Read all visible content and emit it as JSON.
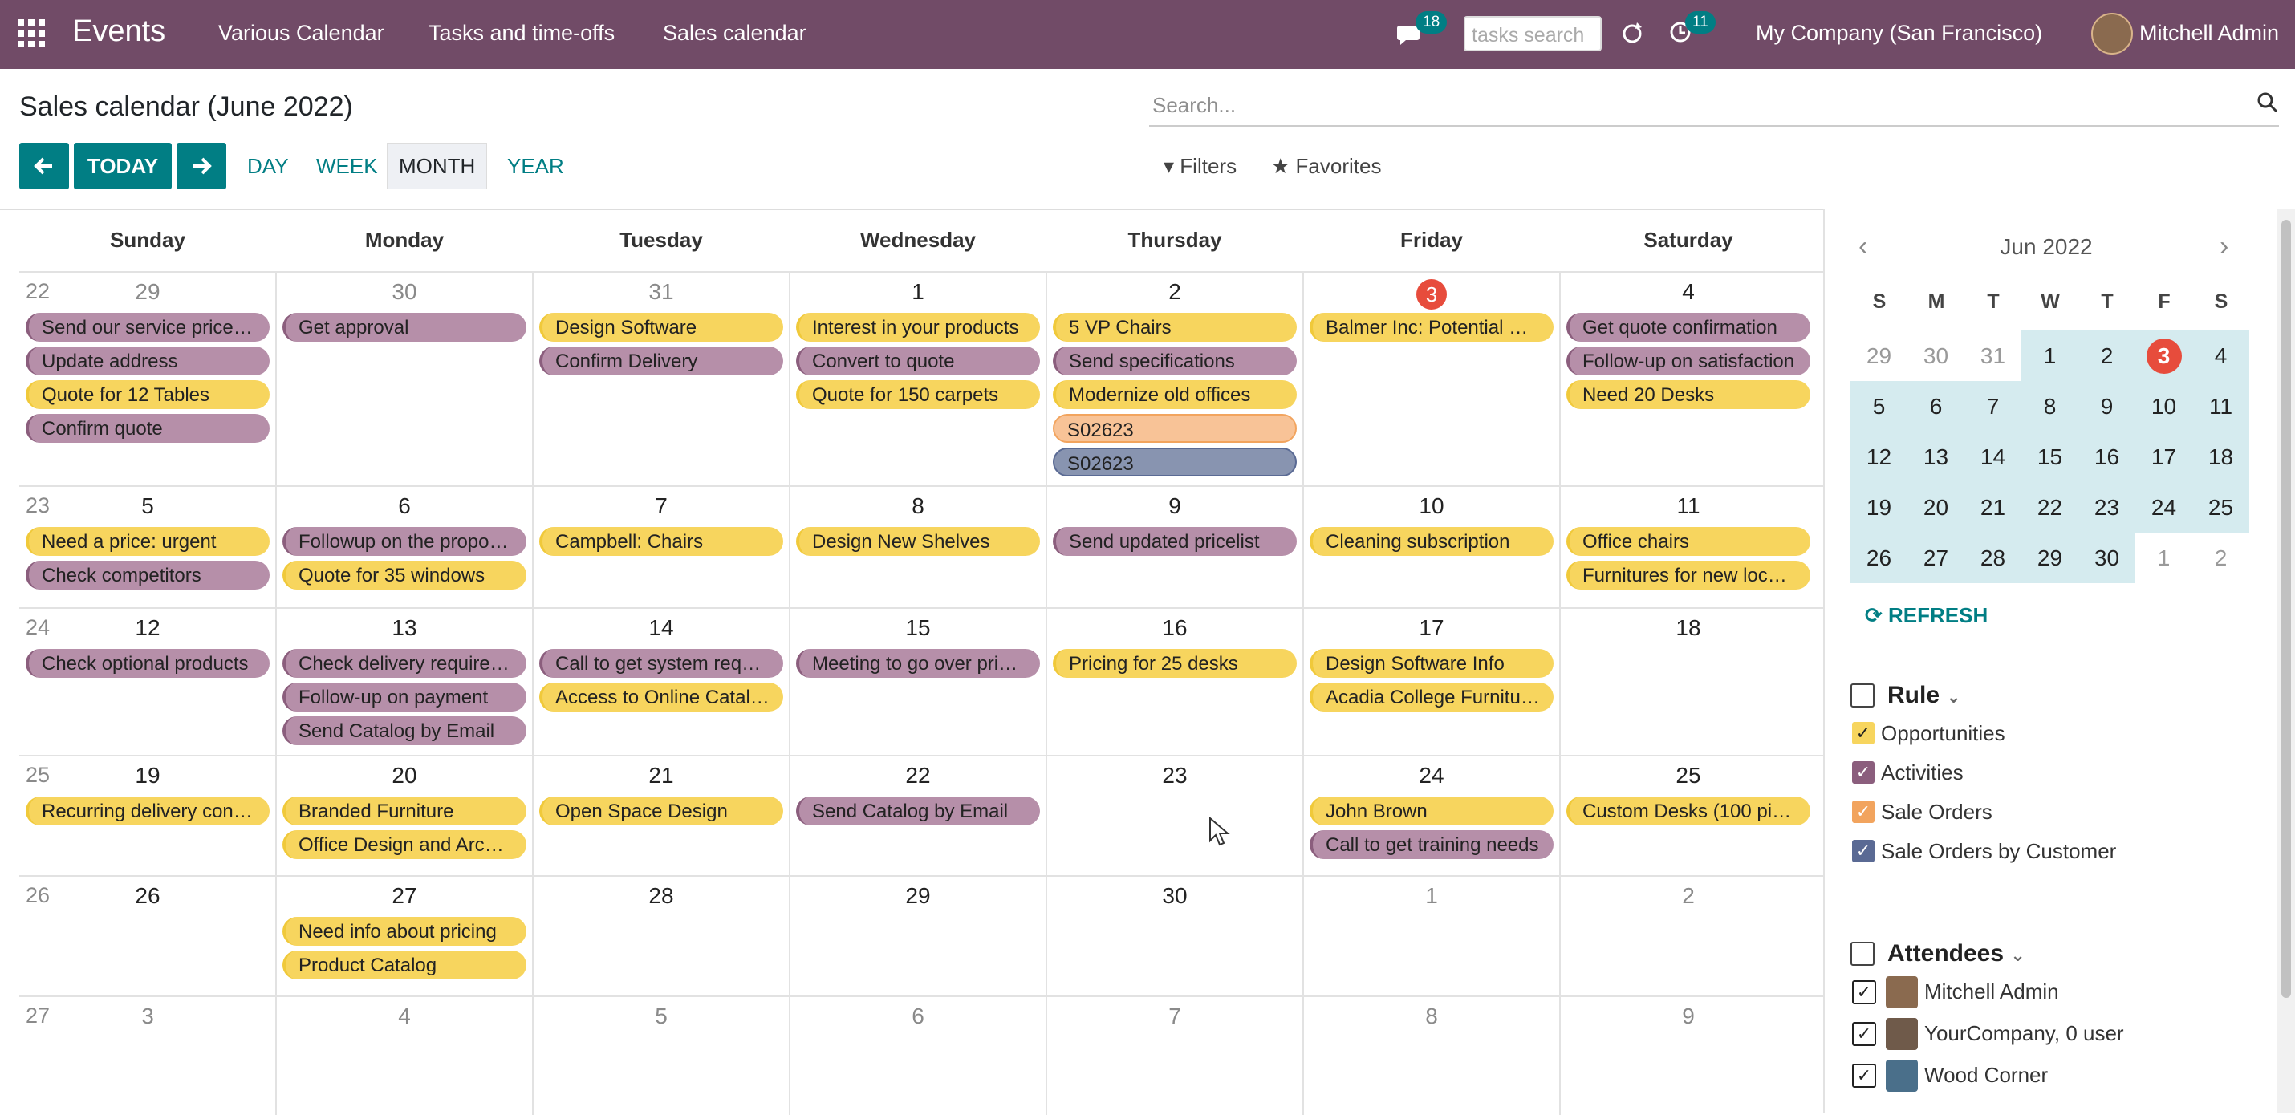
{
  "navbar": {
    "brand": "Events",
    "menu": [
      "Various Calendar",
      "Tasks and time-offs",
      "Sales calendar"
    ],
    "messages_count": "18",
    "activities_count": "11",
    "search_placeholder": "tasks search",
    "company": "My Company (San Francisco)",
    "user": "Mitchell Admin"
  },
  "page": {
    "title": "Sales calendar (June 2022)",
    "search_placeholder": "Search...",
    "today_label": "TODAY",
    "scales": [
      "DAY",
      "WEEK",
      "MONTH",
      "YEAR"
    ],
    "active_scale": "MONTH",
    "filters_label": "Filters",
    "favorites_label": "Favorites"
  },
  "calendar": {
    "day_headers": [
      "Sunday",
      "Monday",
      "Tuesday",
      "Wednesday",
      "Thursday",
      "Friday",
      "Saturday"
    ],
    "weeks": [
      {
        "week": "22",
        "days": [
          {
            "n": "29",
            "muted": true,
            "events": [
              {
                "t": "Send our service pricelist",
                "c": "p"
              },
              {
                "t": "Update address",
                "c": "p"
              },
              {
                "t": "Quote for 12 Tables",
                "c": "y"
              },
              {
                "t": "Confirm quote",
                "c": "p"
              }
            ]
          },
          {
            "n": "30",
            "muted": true,
            "events": [
              {
                "t": "Get approval",
                "c": "p"
              }
            ]
          },
          {
            "n": "31",
            "muted": true,
            "events": [
              {
                "t": "Design Software",
                "c": "y"
              },
              {
                "t": "Confirm Delivery",
                "c": "p"
              }
            ]
          },
          {
            "n": "1",
            "events": [
              {
                "t": "Interest in your products",
                "c": "y"
              },
              {
                "t": "Convert to quote",
                "c": "p"
              },
              {
                "t": "Quote for 150 carpets",
                "c": "y"
              }
            ]
          },
          {
            "n": "2",
            "events": [
              {
                "t": "5 VP Chairs",
                "c": "y"
              },
              {
                "t": "Send specifications",
                "c": "p"
              },
              {
                "t": "Modernize old offices",
                "c": "y"
              },
              {
                "t": "S02623",
                "c": "o"
              },
              {
                "t": "S02623",
                "c": "s"
              }
            ]
          },
          {
            "n": "3",
            "today": true,
            "events": [
              {
                "t": "Balmer Inc: Potential Di...",
                "c": "y"
              }
            ]
          },
          {
            "n": "4",
            "events": [
              {
                "t": "Get quote confirmation",
                "c": "p"
              },
              {
                "t": "Follow-up on satisfaction",
                "c": "p"
              },
              {
                "t": "Need 20 Desks",
                "c": "y"
              }
            ]
          }
        ]
      },
      {
        "week": "23",
        "days": [
          {
            "n": "5",
            "events": [
              {
                "t": "Need a price: urgent",
                "c": "y"
              },
              {
                "t": "Check competitors",
                "c": "p"
              }
            ]
          },
          {
            "n": "6",
            "events": [
              {
                "t": "Followup on the proposal",
                "c": "p"
              },
              {
                "t": "Quote for 35 windows",
                "c": "y"
              }
            ]
          },
          {
            "n": "7",
            "events": [
              {
                "t": "Campbell: Chairs",
                "c": "y"
              }
            ]
          },
          {
            "n": "8",
            "events": [
              {
                "t": "Design New Shelves",
                "c": "y"
              }
            ]
          },
          {
            "n": "9",
            "events": [
              {
                "t": "Send updated pricelist",
                "c": "p"
              }
            ]
          },
          {
            "n": "10",
            "events": [
              {
                "t": "Cleaning subscription",
                "c": "y"
              }
            ]
          },
          {
            "n": "11",
            "events": [
              {
                "t": "Office chairs",
                "c": "y"
              },
              {
                "t": "Furnitures for new locati...",
                "c": "y"
              }
            ]
          }
        ]
      },
      {
        "week": "24",
        "days": [
          {
            "n": "12",
            "events": [
              {
                "t": "Check optional products",
                "c": "p"
              }
            ]
          },
          {
            "n": "13",
            "events": [
              {
                "t": "Check delivery requirem...",
                "c": "p"
              },
              {
                "t": "Follow-up on payment",
                "c": "p"
              },
              {
                "t": "Send Catalog by Email",
                "c": "p"
              }
            ]
          },
          {
            "n": "14",
            "events": [
              {
                "t": "Call to get system requir...",
                "c": "p"
              },
              {
                "t": "Access to Online Catalog",
                "c": "y"
              }
            ]
          },
          {
            "n": "15",
            "events": [
              {
                "t": "Meeting to go over prici...",
                "c": "p"
              }
            ]
          },
          {
            "n": "16",
            "events": [
              {
                "t": "Pricing for 25 desks",
                "c": "y"
              }
            ]
          },
          {
            "n": "17",
            "events": [
              {
                "t": "Design Software Info",
                "c": "y"
              },
              {
                "t": "Acadia College Furnitures",
                "c": "y"
              }
            ]
          },
          {
            "n": "18",
            "events": []
          }
        ]
      },
      {
        "week": "25",
        "days": [
          {
            "n": "19",
            "events": [
              {
                "t": "Recurring delivery contr...",
                "c": "y"
              }
            ]
          },
          {
            "n": "20",
            "events": [
              {
                "t": "Branded Furniture",
                "c": "y"
              },
              {
                "t": "Office Design and Archit...",
                "c": "y"
              }
            ]
          },
          {
            "n": "21",
            "events": [
              {
                "t": "Open Space Design",
                "c": "y"
              }
            ]
          },
          {
            "n": "22",
            "events": [
              {
                "t": "Send Catalog by Email",
                "c": "p"
              }
            ]
          },
          {
            "n": "23",
            "events": []
          },
          {
            "n": "24",
            "events": [
              {
                "t": "John Brown",
                "c": "y"
              },
              {
                "t": "Call to get training needs",
                "c": "p"
              }
            ]
          },
          {
            "n": "25",
            "events": [
              {
                "t": "Custom Desks (100 piec...",
                "c": "y"
              }
            ]
          }
        ]
      },
      {
        "week": "26",
        "days": [
          {
            "n": "26",
            "events": []
          },
          {
            "n": "27",
            "events": [
              {
                "t": "Need info about pricing",
                "c": "y"
              },
              {
                "t": "Product Catalog",
                "c": "y"
              }
            ]
          },
          {
            "n": "28",
            "events": []
          },
          {
            "n": "29",
            "events": []
          },
          {
            "n": "30",
            "events": []
          },
          {
            "n": "1",
            "muted": true,
            "events": []
          },
          {
            "n": "2",
            "muted": true,
            "events": []
          }
        ]
      },
      {
        "week": "27",
        "days": [
          {
            "n": "3",
            "muted": true,
            "events": []
          },
          {
            "n": "4",
            "muted": true,
            "events": []
          },
          {
            "n": "5",
            "muted": true,
            "events": []
          },
          {
            "n": "6",
            "muted": true,
            "events": []
          },
          {
            "n": "7",
            "muted": true,
            "events": []
          },
          {
            "n": "8",
            "muted": true,
            "events": []
          },
          {
            "n": "9",
            "muted": true,
            "events": []
          }
        ]
      }
    ]
  },
  "sidebar": {
    "month_label": "Jun 2022",
    "dow": [
      "S",
      "M",
      "T",
      "W",
      "T",
      "F",
      "S"
    ],
    "mini_weeks": [
      [
        "29",
        "30",
        "31",
        "1",
        "2",
        "3",
        "4"
      ],
      [
        "5",
        "6",
        "7",
        "8",
        "9",
        "10",
        "11"
      ],
      [
        "12",
        "13",
        "14",
        "15",
        "16",
        "17",
        "18"
      ],
      [
        "19",
        "20",
        "21",
        "22",
        "23",
        "24",
        "25"
      ],
      [
        "26",
        "27",
        "28",
        "29",
        "30",
        "1",
        "2"
      ]
    ],
    "refresh_label": "REFRESH",
    "rule_title": "Rule",
    "rule_items": [
      {
        "label": "Opportunities",
        "color": "#f7d55e"
      },
      {
        "label": "Activities",
        "color": "#8b5e7d"
      },
      {
        "label": "Sale Orders",
        "color": "#f2a45e"
      },
      {
        "label": "Sale Orders by Customer",
        "color": "#5a6a94"
      }
    ],
    "attendees_title": "Attendees",
    "attendees": [
      "Mitchell Admin",
      "YourCompany, 0 user",
      "Wood Corner"
    ]
  }
}
